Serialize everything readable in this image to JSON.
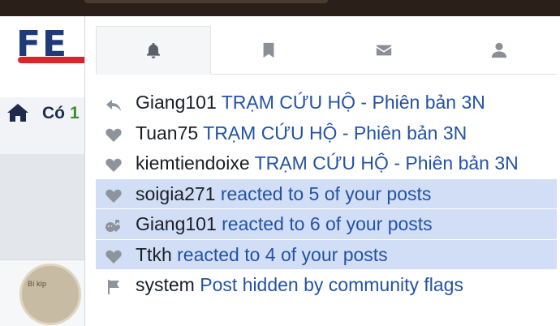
{
  "logo": {
    "text": "FE"
  },
  "background": {
    "home_label": "Có",
    "home_count": "1"
  },
  "avatar_text": "Bí kíp",
  "tabs": [
    {
      "name": "alerts",
      "icon": "bell-icon",
      "active": true
    },
    {
      "name": "bookmarks",
      "icon": "bookmark-icon",
      "active": false
    },
    {
      "name": "conversations",
      "icon": "envelope-icon",
      "active": false
    },
    {
      "name": "account",
      "icon": "user-icon",
      "active": false
    }
  ],
  "alerts": [
    {
      "icon": "reply-icon",
      "user": "Giang101",
      "link": "TRẠM CỨU HỘ - Phiên bản 3N",
      "unread": false
    },
    {
      "icon": "heart-icon",
      "user": "Tuan75",
      "link": "TRẠM CỨU HỘ - Phiên bản 3N",
      "unread": false
    },
    {
      "icon": "heart-icon",
      "user": "kiemtiendoixe",
      "link": "TRẠM CỨU HỘ - Phiên bản 3N",
      "unread": false
    },
    {
      "icon": "heart-icon",
      "user": "soigia271",
      "link": "reacted to 5 of your posts",
      "unread": true
    },
    {
      "icon": "mixed-reactions-icon",
      "user": "Giang101",
      "link": "reacted to 6 of your posts",
      "unread": true
    },
    {
      "icon": "heart-icon",
      "user": "Ttkh",
      "link": "reacted to 4 of your posts",
      "unread": true
    },
    {
      "icon": "flag-icon",
      "user": "system",
      "link": "Post hidden by community flags",
      "unread": false
    }
  ],
  "colors": {
    "accent_link": "#2352a6",
    "unread_bg": "#d2def5",
    "logo_red": "#d9262c",
    "logo_blue": "#1f3a78"
  }
}
